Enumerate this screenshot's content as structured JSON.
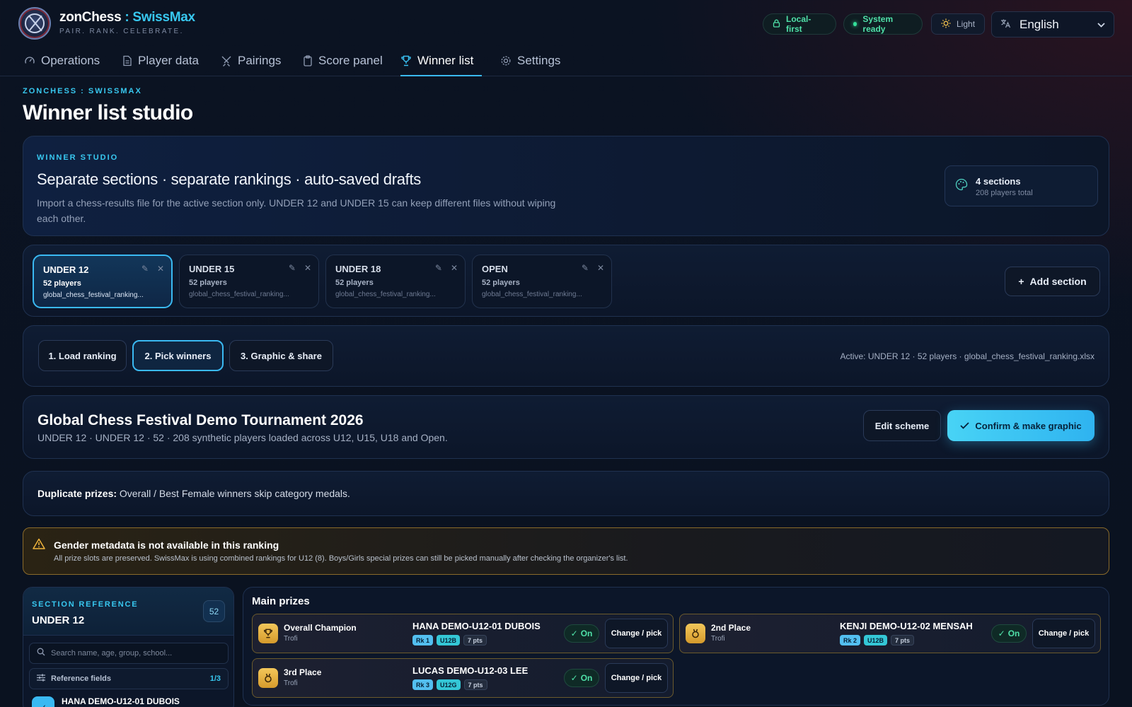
{
  "app": {
    "name_part1": "zonChess",
    "name_sep": " : ",
    "name_part2": "SwissMax",
    "tagline": "PAIR. RANK. CELEBRATE."
  },
  "header": {
    "local_first": "Local-first",
    "system_ready": "System ready",
    "theme": "Light",
    "language": "English"
  },
  "nav": [
    {
      "label": "Operations",
      "icon": "gauge-icon"
    },
    {
      "label": "Player data",
      "icon": "document-icon"
    },
    {
      "label": "Pairings",
      "icon": "swords-icon"
    },
    {
      "label": "Score panel",
      "icon": "clipboard-icon"
    },
    {
      "label": "Winner list",
      "icon": "trophy-icon",
      "active": true
    },
    {
      "label": "Settings",
      "icon": "gear-icon"
    }
  ],
  "page": {
    "kicker": "ZONCHESS : SWISSMAX",
    "title": "Winner list studio"
  },
  "studio": {
    "kicker": "WINNER STUDIO",
    "heading": "Separate sections · separate rankings · auto-saved drafts",
    "description": "Import a chess-results file for the active section only. UNDER 12 and UNDER 15 can keep different files without wiping each other.",
    "sections_count": "4 sections",
    "players_total": "208 players total"
  },
  "sections": [
    {
      "name": "UNDER 12",
      "players": "52 players",
      "file": "global_chess_festival_ranking...",
      "active": true
    },
    {
      "name": "UNDER 15",
      "players": "52 players",
      "file": "global_chess_festival_ranking..."
    },
    {
      "name": "UNDER 18",
      "players": "52 players",
      "file": "global_chess_festival_ranking..."
    },
    {
      "name": "OPEN",
      "players": "52 players",
      "file": "global_chess_festival_ranking..."
    }
  ],
  "add_section_label": "Add section",
  "steps": {
    "items": [
      "1. Load ranking",
      "2. Pick winners",
      "3. Graphic & share"
    ],
    "active_index": 1,
    "active_info": "Active: UNDER 12 · 52 players · global_chess_festival_ranking.xlsx"
  },
  "tournament": {
    "title": "Global Chess Festival Demo Tournament 2026",
    "subtitle": "UNDER 12 · UNDER 12 · 52 · 208 synthetic players loaded across U12, U15, U18 and Open.",
    "edit_label": "Edit scheme",
    "confirm_label": "Confirm & make graphic"
  },
  "duplicate": {
    "label": "Duplicate prizes:",
    "text": " Overall / Best Female winners skip category medals."
  },
  "warning": {
    "title": "Gender metadata is not available in this ranking",
    "text": "All prize slots are preserved. SwissMax is using combined rankings for U12 (8). Boys/Girls special prizes can still be picked manually after checking the organizer's list."
  },
  "reference": {
    "kicker": "SECTION REFERENCE",
    "name": "UNDER 12",
    "count": "52",
    "search_placeholder": "Search name, age, group, school...",
    "fields_label": "Reference fields",
    "fields_count": "1/3",
    "first_player": "HANA DEMO-U12-01 DUBOIS"
  },
  "main_prizes": {
    "title": "Main prizes",
    "on_label": "On",
    "change_label": "Change / pick",
    "items": [
      {
        "title": "Overall Champion",
        "type": "Trofi",
        "player": "HANA DEMO-U12-01 DUBOIS",
        "rank": "Rk 1",
        "group": "U12B",
        "points": "7 pts",
        "icon": "trophy-icon"
      },
      {
        "title": "2nd Place",
        "type": "Trofi",
        "player": "KENJI DEMO-U12-02 MENSAH",
        "rank": "Rk 2",
        "group": "U12B",
        "points": "7 pts",
        "icon": "medal-icon"
      },
      {
        "title": "3rd Place",
        "type": "Trofi",
        "player": "LUCAS DEMO-U12-03 LEE",
        "rank": "Rk 3",
        "group": "U12G",
        "points": "7 pts",
        "icon": "medal-icon"
      }
    ]
  }
}
